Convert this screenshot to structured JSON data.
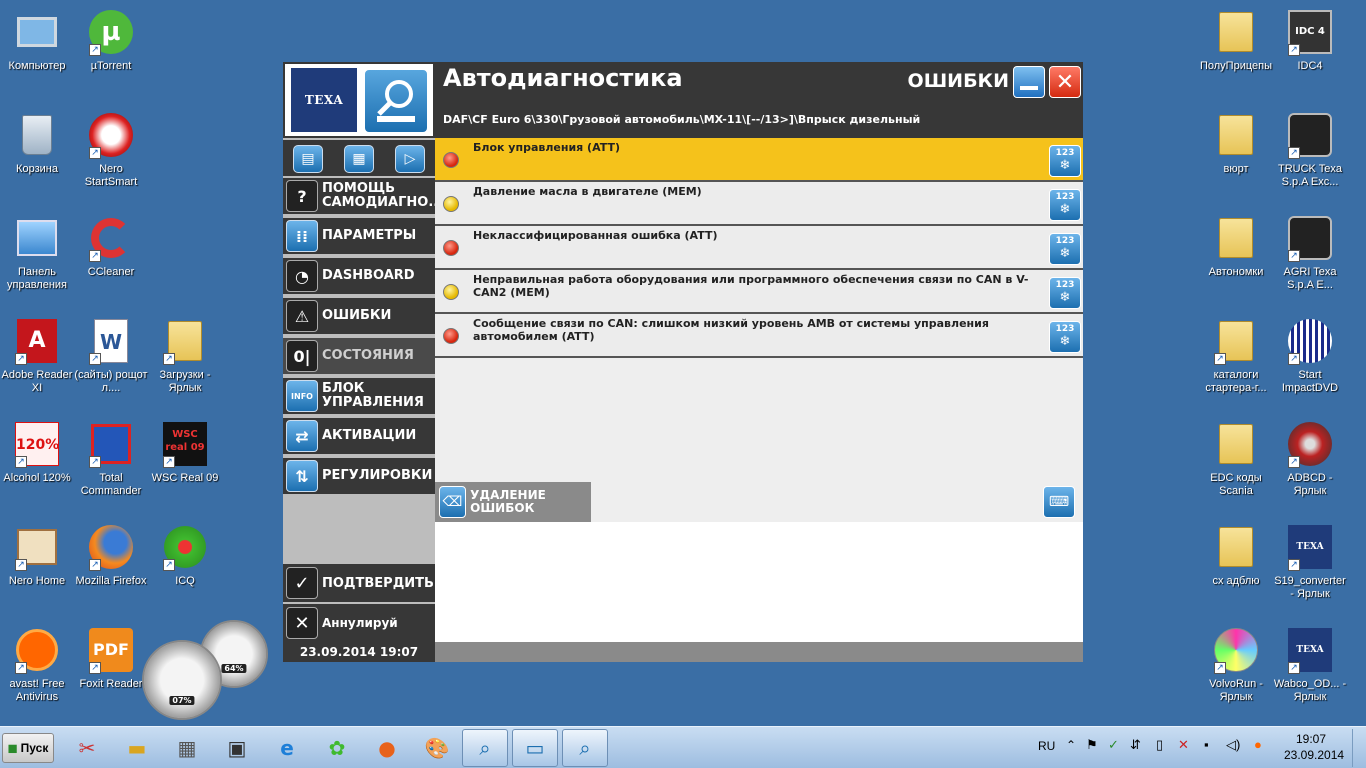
{
  "desktop": {
    "left_icons": [
      {
        "label": "Компьютер"
      },
      {
        "label": "µTorrent"
      },
      {
        "label": "Корзина"
      },
      {
        "label": "Nero StartSmart"
      },
      {
        "label": "Панель управления"
      },
      {
        "label": "CCleaner"
      },
      {
        "label": "Adobe Reader XI"
      },
      {
        "label": "(сайты) рощот л...."
      },
      {
        "label": "Загрузки - Ярлык"
      },
      {
        "label": "Alcohol 120%"
      },
      {
        "label": "Total Commander"
      },
      {
        "label": "WSC Real 09"
      },
      {
        "label": "Nero Home"
      },
      {
        "label": "Mozilla Firefox"
      },
      {
        "label": "ICQ"
      },
      {
        "label": "avast! Free Antivirus"
      },
      {
        "label": "Foxit Reader"
      }
    ],
    "right_icons": [
      {
        "label": "ПолуПрицепы"
      },
      {
        "label": "IDC4"
      },
      {
        "label": "вюрт"
      },
      {
        "label": "TRUCK Texa S.p.A Exc..."
      },
      {
        "label": "Автономки"
      },
      {
        "label": "AGRI Texa S.p.A E..."
      },
      {
        "label": "каталоги стартера-г..."
      },
      {
        "label": "Start ImpactDVD"
      },
      {
        "label": "EDC коды Scania"
      },
      {
        "label": "ADBCD - Ярлык"
      },
      {
        "label": "сх адблю"
      },
      {
        "label": "S19_converter - Ярлык"
      },
      {
        "label": "VolvoRun - Ярлык"
      },
      {
        "label": "Wabco_OD... - Ярлык"
      }
    ],
    "icon_text": {
      "idc4": "IDC 4",
      "wsc": "WSC real 09",
      "alcohol": "120%",
      "texa": "TEXA"
    },
    "gadget": {
      "cpu": "07%",
      "mem": "64%"
    }
  },
  "app": {
    "brand": "TEXA",
    "title": "Автодиагностика",
    "section": "ОШИБКИ",
    "path": "DAF\\CF Euro 6\\330\\Грузовой автомобиль\\MX-11\\[--/13>]\\Впрыск дизельный",
    "menu": [
      {
        "label": "ПОМОЩЬ САМОДИАГНО..."
      },
      {
        "label": "ПАРАМЕТРЫ"
      },
      {
        "label": "DASHBOARD"
      },
      {
        "label": "ОШИБКИ"
      },
      {
        "label": "СОСТОЯНИЯ"
      },
      {
        "label": "БЛОК УПРАВЛЕНИЯ"
      },
      {
        "label": "АКТИВАЦИИ"
      },
      {
        "label": "РЕГУЛИРОВКИ"
      }
    ],
    "info_badge": "INFO",
    "confirm_label": "ПОДТВЕРДИТЬ",
    "cancel_label": "Аннулируй",
    "datetime": "23.09.2014  19:07",
    "errors": [
      {
        "text": "Блок управления (ATT)",
        "status": "red"
      },
      {
        "text": "Давление масла в двигателе (MEM)",
        "status": "yellow"
      },
      {
        "text": "Неклассифицированная ошибка (ATT)",
        "status": "red"
      },
      {
        "text": "Неправильная работа оборудования или программного обеспечения связи по CAN в V-CAN2 (MEM)",
        "status": "yellow"
      },
      {
        "text": "Сообщение связи по CAN: слишком низкий уровень AMB от системы управления автомобилем (ATT)",
        "status": "red"
      }
    ],
    "freeze_label": "123",
    "delete_label": "УДАЛЕНИЕ ОШИБОК",
    "colors": {
      "selected": "#f5c21b",
      "dark": "#373737",
      "accent": "#1c6fb0"
    }
  },
  "taskbar": {
    "start_label": "Пуск",
    "lang": "RU",
    "time": "19:07",
    "date": "23.09.2014"
  }
}
